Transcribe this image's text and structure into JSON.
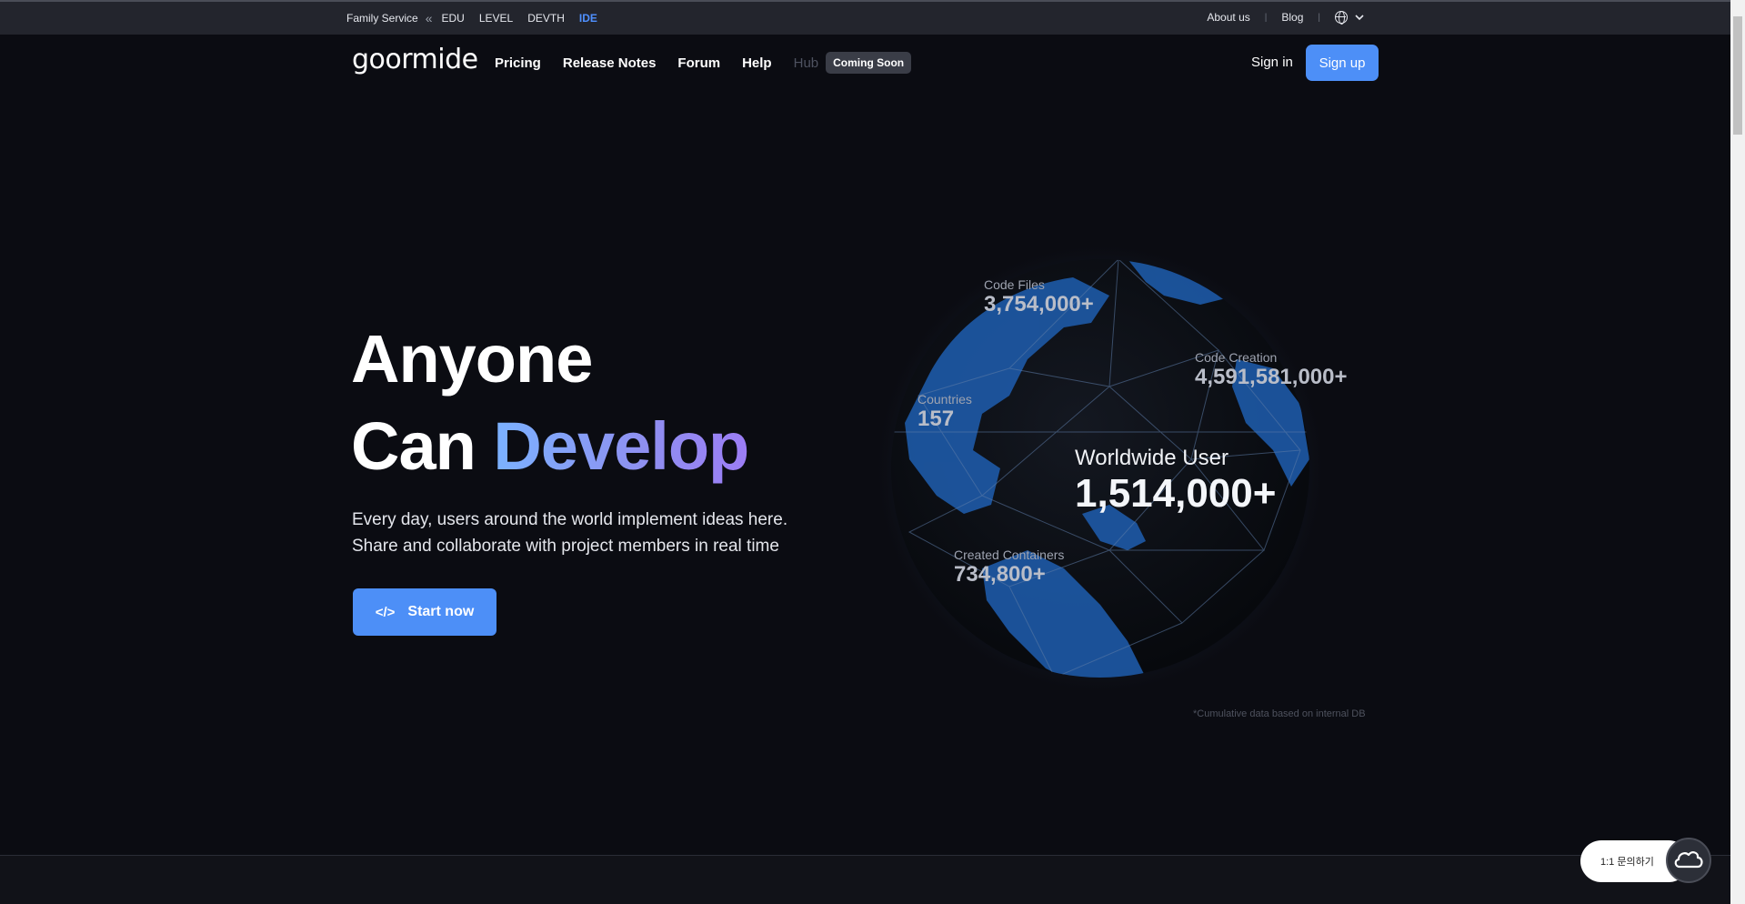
{
  "family_bar": {
    "label": "Family Service",
    "chevron": "«",
    "services": [
      "EDU",
      "LEVEL",
      "DEVTH",
      "IDE"
    ],
    "active_service": "IDE",
    "about": "About us",
    "blog": "Blog",
    "separator": "|"
  },
  "nav": {
    "logo": "goormide",
    "links": [
      "Pricing",
      "Release Notes",
      "Forum",
      "Help"
    ],
    "hub": "Hub",
    "badge": "Coming Soon",
    "signin": "Sign in",
    "signup": "Sign up"
  },
  "hero": {
    "line1": "Anyone",
    "line2_plain": "Can ",
    "line2_highlight": "Develop",
    "desc1": "Every day, users around the world implement ideas here.",
    "desc2": "Share and collaborate with project members in real time",
    "cta": "Start now",
    "cta_icon": "</>"
  },
  "stats": {
    "code_files": {
      "label": "Code Files",
      "value": "3,754,000+"
    },
    "code_creation": {
      "label": "Code Creation",
      "value": "4,591,581,000+"
    },
    "countries": {
      "label": "Countries",
      "value": "157"
    },
    "worldwide": {
      "label": "Worldwide User",
      "value": "1,514,000+"
    },
    "containers": {
      "label": "Created Containers",
      "value": "734,800+"
    },
    "footnote": "*Cumulative data based on internal DB"
  },
  "widget": {
    "inquiry": "1:1 문의하기"
  },
  "colors": {
    "accent": "#4d8ff7",
    "background": "#0b0c12",
    "topbar": "#23252d"
  }
}
